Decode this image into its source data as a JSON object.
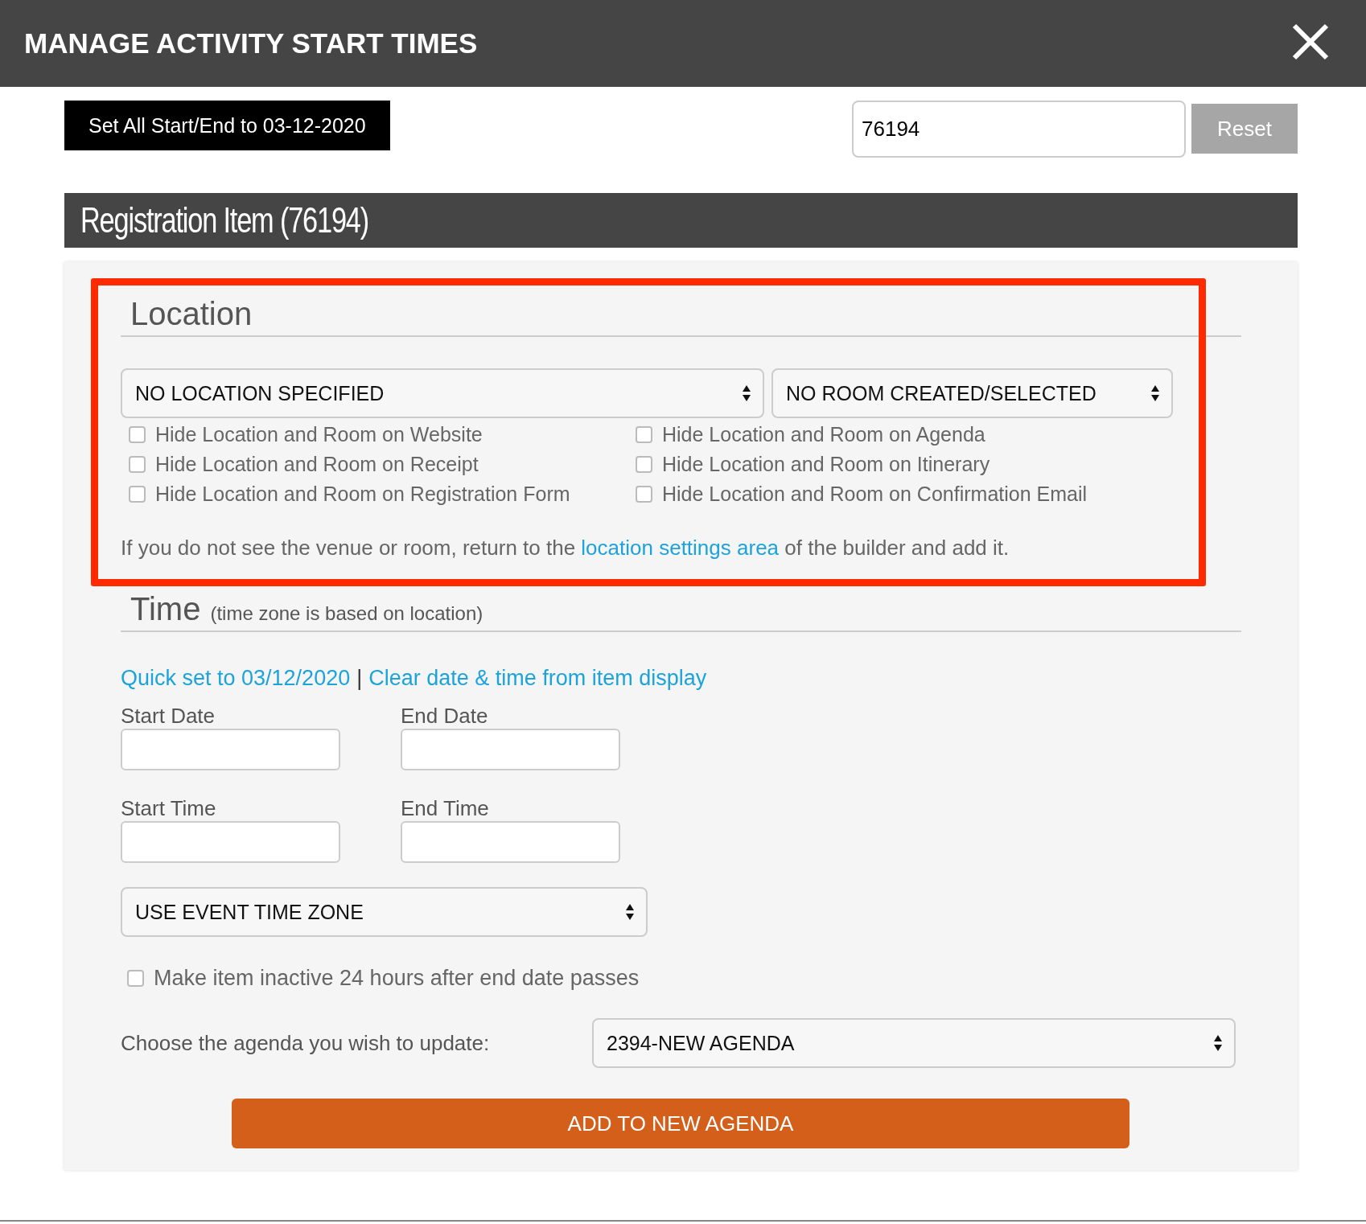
{
  "dialog": {
    "title": "MANAGE ACTIVITY START TIMES"
  },
  "toolbar": {
    "set_all_button": "Set All Start/End to 03-12-2020",
    "item_id_value": "76194",
    "reset_button": "Reset"
  },
  "section_title": "Registration Item (76194)",
  "location": {
    "heading": "Location",
    "highlighted": true,
    "location_select": "NO LOCATION SPECIFIED",
    "room_select": "NO ROOM CREATED/SELECTED",
    "options": [
      {
        "label": "Hide Location and Room on Website",
        "checked": false
      },
      {
        "label": "Hide Location and Room on Agenda",
        "checked": false
      },
      {
        "label": "Hide Location and Room on Receipt",
        "checked": false
      },
      {
        "label": "Hide Location and Room on Itinerary",
        "checked": false
      },
      {
        "label": "Hide Location and Room on Registration Form",
        "checked": false
      },
      {
        "label": "Hide Location and Room on Confirmation Email",
        "checked": false
      }
    ],
    "note_before": "If you do not see the venue or room, return to the ",
    "note_link": "location settings area",
    "note_after": " of the builder and add it."
  },
  "time": {
    "heading": "Time",
    "subheading": "(time zone is based on location)",
    "quick_set_link": "Quick set to 03/12/2020",
    "separator": "|",
    "clear_link": "Clear date & time from item display",
    "fields": [
      {
        "label": "Start Date"
      },
      {
        "label": "End Date"
      },
      {
        "label": "Start Time"
      },
      {
        "label": "End Time"
      }
    ],
    "time_zone_select": "USE EVENT TIME ZONE",
    "inactive_option": {
      "label": "Make item inactive 24 hours after end date passes",
      "checked": false
    },
    "agenda_label": "Choose the agenda you wish to update:",
    "agenda_select": "2394-NEW AGENDA",
    "add_button": "ADD TO NEW AGENDA"
  }
}
